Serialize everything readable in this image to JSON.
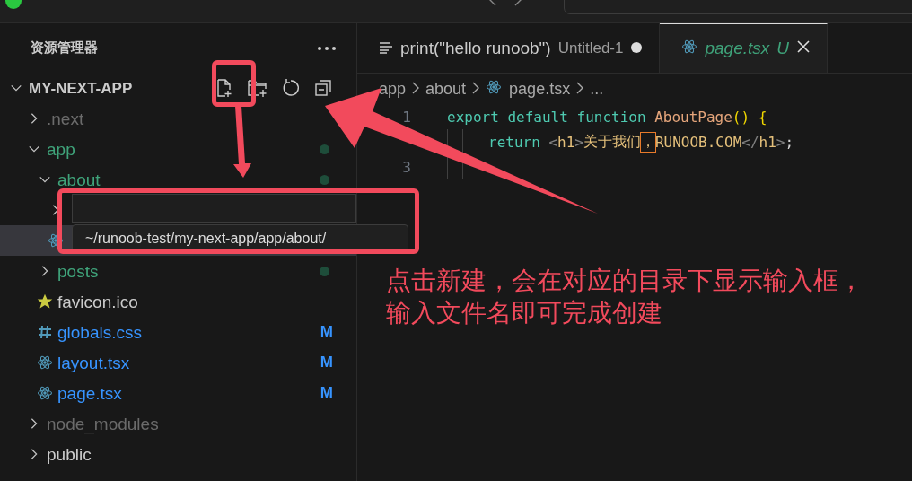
{
  "explorer": {
    "title": "资源管理器",
    "root": {
      "label": "MY-NEXT-APP",
      "expanded": true,
      "children": [
        {
          "kind": "folder",
          "label": ".next",
          "expanded": false,
          "color": "#6b6b6b",
          "selected": false
        },
        {
          "kind": "folder",
          "label": "app",
          "expanded": true,
          "color": "#3fa37a",
          "dot": true,
          "selected": false,
          "children": [
            {
              "kind": "folder",
              "label": "about",
              "expanded": true,
              "color": "#3fa37a",
              "dot": true,
              "selected": false,
              "children": [
                {
                  "kind": "folder",
                  "expanded": false,
                  "selected": false
                },
                {
                  "kind": "react",
                  "selected": true
                }
              ]
            },
            {
              "kind": "folder",
              "label": "posts",
              "expanded": false,
              "color": "#3fa37a",
              "dot": true,
              "selected": false
            },
            {
              "kind": "favicon",
              "label": "favicon.ico",
              "selected": false
            },
            {
              "kind": "css",
              "label": "globals.css",
              "color": "#3794ff",
              "badge": "M",
              "selected": false
            },
            {
              "kind": "react",
              "label": "layout.tsx",
              "color": "#3794ff",
              "badge": "M",
              "selected": false
            },
            {
              "kind": "react",
              "label": "page.tsx",
              "color": "#3794ff",
              "badge": "M",
              "selected": false
            }
          ]
        },
        {
          "kind": "folder",
          "label": "node_modules",
          "expanded": false,
          "color": "#6b6b6b",
          "selected": false
        },
        {
          "kind": "folder",
          "label": "public",
          "expanded": false,
          "selected": false
        }
      ]
    },
    "new_file_input": {
      "hint": "~/runoob-test/my-next-app/app/about/"
    }
  },
  "editor": {
    "tabs": [
      {
        "kind": "untitled",
        "label": "print(\"hello runoob\")",
        "description": "Untitled-1",
        "dirty": true,
        "selected": false
      },
      {
        "kind": "react",
        "label": "page.tsx",
        "status_letter": "U",
        "color": "#3fa37a",
        "preview": true,
        "selected": true
      }
    ],
    "breadcrumbs": [
      {
        "label": "app"
      },
      {
        "label": "about"
      },
      {
        "label": "page.tsx",
        "kind": "react"
      },
      {
        "label": "..."
      }
    ],
    "lines": [
      {
        "number": "1",
        "tokens": [
          {
            "text": "export default function",
            "kind": "keyword"
          },
          {
            "text": "AboutPage",
            "kind": "function"
          },
          {
            "text": "() {",
            "kind": "bracket"
          }
        ]
      },
      {
        "indented": true,
        "tokens": [
          {
            "text": "return",
            "kind": "keyword"
          },
          {
            "text": "<",
            "kind": "angle"
          },
          {
            "text": "h1",
            "kind": "tag"
          },
          {
            "text": ">",
            "kind": "angle"
          },
          {
            "text": "关于我们",
            "kind": "text"
          },
          {
            "text": "，",
            "kind": "unicode-highlight"
          },
          {
            "text": "RUNOOB.COM",
            "kind": "text"
          },
          {
            "text": "</",
            "kind": "angle"
          },
          {
            "text": "h1",
            "kind": "tag"
          },
          {
            "text": ">",
            "kind": "angle"
          },
          {
            "text": ";",
            "kind": "plain"
          }
        ]
      },
      {
        "number": "3",
        "indented": true
      }
    ]
  },
  "annotation": {
    "text_lines": [
      "点击新建，会在对应的目录下显示输入框，",
      "输入文件名即可完成创建"
    ]
  }
}
